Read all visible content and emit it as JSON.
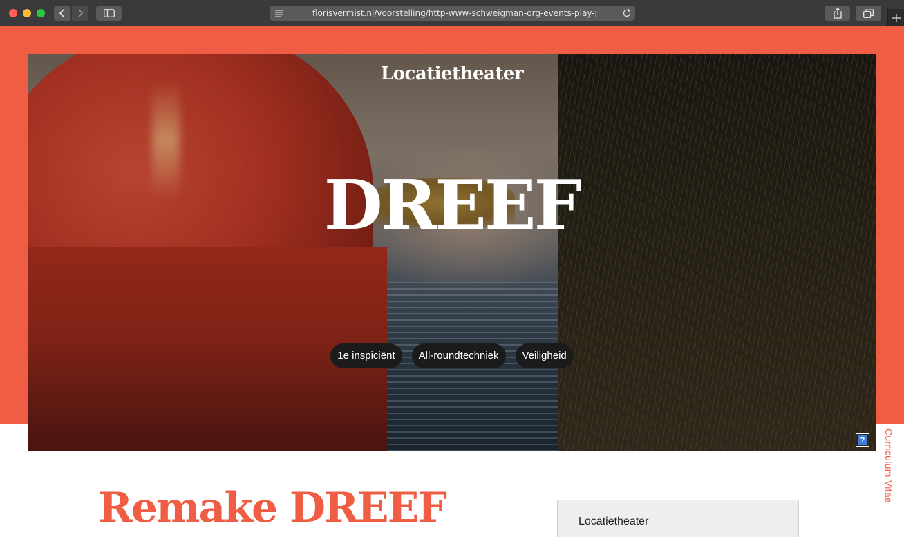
{
  "browser": {
    "url": "florisvermist.nl/voorstelling/http-www-schweigman-org-events-play-pa"
  },
  "hero": {
    "category": "Locatietheater",
    "title": "DREEF",
    "tags": [
      "1e inspiciënt",
      "All-roundtechniek",
      "Veiligheid"
    ],
    "help_badge": "?"
  },
  "side_link": "Curriculum Vitae",
  "content": {
    "title": "Remake DREEF",
    "info_label": "Locatietheater"
  },
  "colors": {
    "accent": "#ef5d45",
    "pill_bg": "#1b1b1b",
    "chrome": "#3a3a3c"
  }
}
